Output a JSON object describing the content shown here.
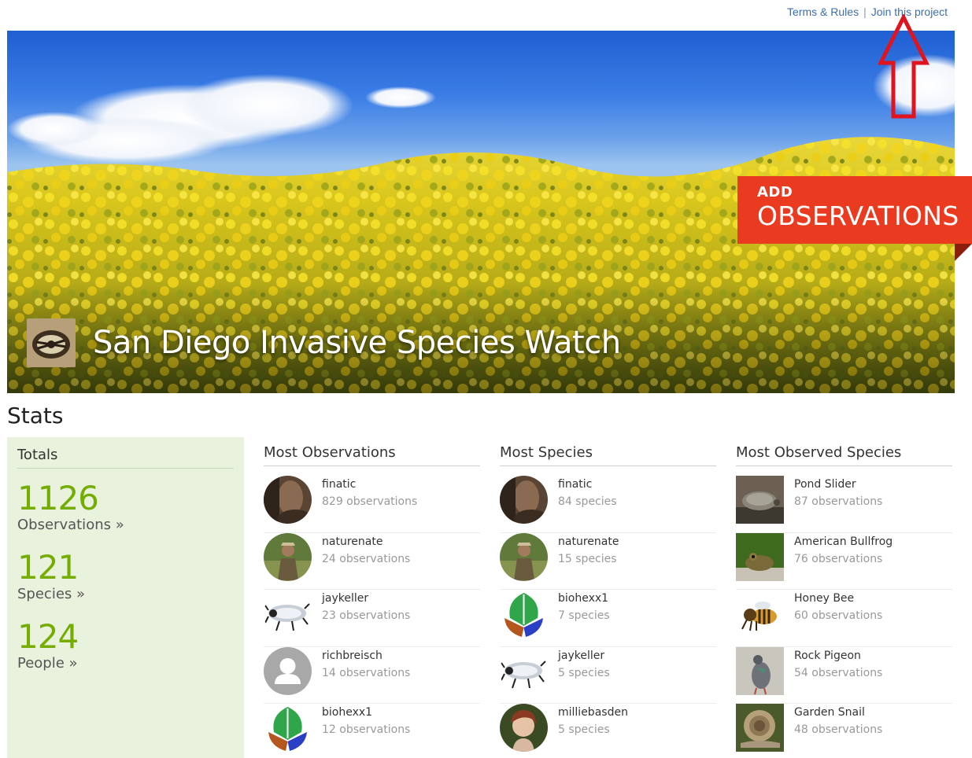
{
  "header": {
    "links": [
      {
        "label": "Terms & Rules"
      },
      {
        "label": "Join this project"
      }
    ],
    "separator": "|"
  },
  "banner": {
    "title": "San Diego Invasive Species Watch",
    "add_observations": {
      "line1": "ADD",
      "line2": "OBSERVATIONS"
    },
    "colors": {
      "accent": "#ea3b20",
      "sky": "#3c7ee6",
      "flowers": "#f2d51c"
    }
  },
  "stats": {
    "heading": "Stats",
    "totals": {
      "heading": "Totals",
      "items": [
        {
          "number": "1126",
          "label": "Observations »"
        },
        {
          "number": "121",
          "label": "Species »"
        },
        {
          "number": "124",
          "label": "People »"
        }
      ]
    },
    "most_observations": {
      "heading": "Most Observations",
      "rows": [
        {
          "name": "finatic",
          "count": "829 observations",
          "icon": "user-photo-icon"
        },
        {
          "name": "naturenate",
          "count": "24 observations",
          "icon": "user-photo-icon"
        },
        {
          "name": "jaykeller",
          "count": "23 observations",
          "icon": "beetle-icon"
        },
        {
          "name": "richbreisch",
          "count": "14 observations",
          "icon": "default-person-icon"
        },
        {
          "name": "biohexx1",
          "count": "12 observations",
          "icon": "leaf-logo-icon"
        }
      ]
    },
    "most_species": {
      "heading": "Most Species",
      "rows": [
        {
          "name": "finatic",
          "count": "84 species",
          "icon": "user-photo-icon"
        },
        {
          "name": "naturenate",
          "count": "15 species",
          "icon": "user-photo-icon"
        },
        {
          "name": "biohexx1",
          "count": "7 species",
          "icon": "leaf-logo-icon"
        },
        {
          "name": "jaykeller",
          "count": "5 species",
          "icon": "beetle-icon"
        },
        {
          "name": "milliebasden",
          "count": "5 species",
          "icon": "user-photo-icon"
        }
      ]
    },
    "most_observed_species": {
      "heading": "Most Observed Species",
      "rows": [
        {
          "name": "Pond Slider",
          "count": "87 observations",
          "icon": "turtle-photo-icon"
        },
        {
          "name": "American Bullfrog",
          "count": "76 observations",
          "icon": "frog-photo-icon"
        },
        {
          "name": "Honey Bee",
          "count": "60 observations",
          "icon": "bee-photo-icon"
        },
        {
          "name": "Rock Pigeon",
          "count": "54 observations",
          "icon": "pigeon-photo-icon"
        },
        {
          "name": "Garden Snail",
          "count": "48 observations",
          "icon": "snail-photo-icon"
        }
      ]
    }
  }
}
